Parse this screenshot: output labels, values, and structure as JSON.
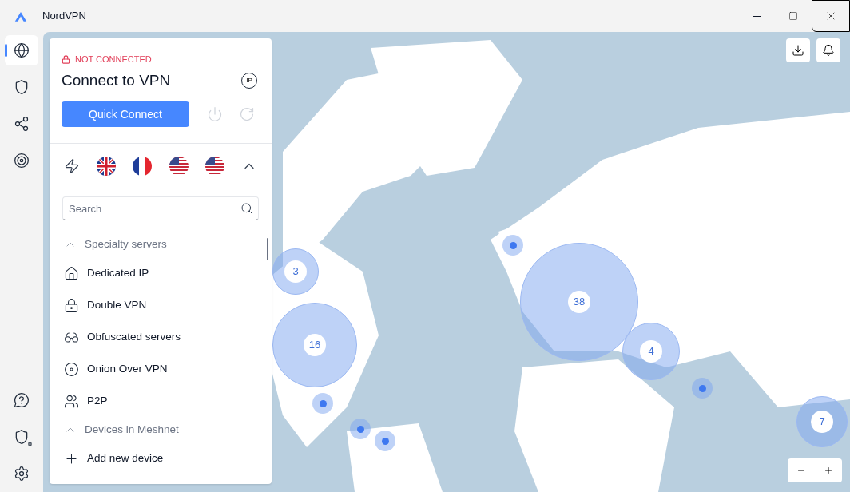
{
  "window": {
    "title": "NordVPN"
  },
  "rail": {
    "top": [
      {
        "kind": "globe",
        "selected": true
      },
      {
        "kind": "shield",
        "selected": false
      },
      {
        "kind": "meshnet",
        "selected": false
      },
      {
        "kind": "target",
        "selected": false
      }
    ],
    "bottom": [
      {
        "kind": "help"
      },
      {
        "kind": "threat",
        "badge": "0"
      },
      {
        "kind": "settings"
      }
    ]
  },
  "panel": {
    "status": "NOT CONNECTED",
    "title": "Connect to VPN",
    "ip_badge": "IP",
    "quick_connect": "Quick Connect",
    "recent": [
      {
        "kind": "bolt"
      },
      {
        "kind": "uk"
      },
      {
        "kind": "fr"
      },
      {
        "kind": "us"
      },
      {
        "kind": "us"
      }
    ],
    "search": {
      "placeholder": "Search"
    },
    "sections": [
      {
        "title": "Specialty servers",
        "expanded": true,
        "items": [
          {
            "kind": "dedicated",
            "label": "Dedicated IP"
          },
          {
            "kind": "double",
            "label": "Double VPN"
          },
          {
            "kind": "obfuscated",
            "label": "Obfuscated servers"
          },
          {
            "kind": "onion",
            "label": "Onion Over VPN"
          },
          {
            "kind": "p2p",
            "label": "P2P"
          }
        ]
      },
      {
        "title": "Devices in Meshnet",
        "expanded": true,
        "items": [
          {
            "kind": "add",
            "label": "Add new device"
          }
        ]
      }
    ]
  },
  "map": {
    "clusters": [
      {
        "count": "3"
      },
      {
        "count": "16"
      },
      {
        "count": "38"
      },
      {
        "count": "4"
      },
      {
        "count": "7"
      }
    ]
  }
}
